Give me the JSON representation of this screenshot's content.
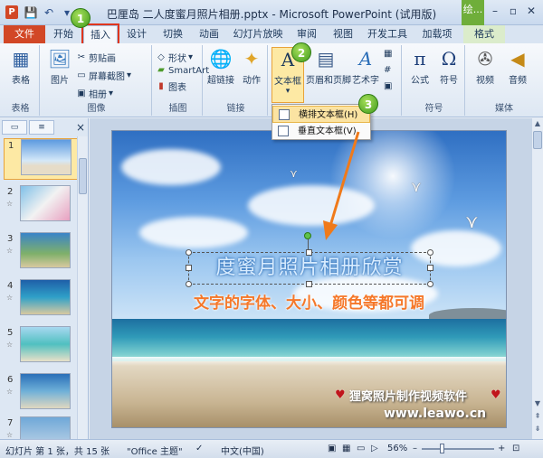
{
  "window": {
    "app_icon": "P",
    "title": "巴厘岛 二人度蜜月照片相册.pptx - Microsoft PowerPoint (试用版)",
    "context_tab_title": "绘...",
    "buttons": [
      "minimize-icon",
      "maximize-icon",
      "close-icon"
    ]
  },
  "qat": [
    "save-icon",
    "undo-icon",
    "customize-icon"
  ],
  "tabs": [
    {
      "label": "文件"
    },
    {
      "label": "开始"
    },
    {
      "label": "插入"
    },
    {
      "label": "设计"
    },
    {
      "label": "切换"
    },
    {
      "label": "动画"
    },
    {
      "label": "幻灯片放映"
    },
    {
      "label": "审阅"
    },
    {
      "label": "视图"
    },
    {
      "label": "开发工具"
    },
    {
      "label": "加载项"
    },
    {
      "label": "格式"
    }
  ],
  "ribbon": {
    "groups": [
      {
        "label": "表格",
        "buttons": [
          {
            "label": "表格"
          }
        ]
      },
      {
        "label": "图像",
        "buttons": [
          {
            "label": "图片"
          },
          {
            "label": "剪贴画"
          },
          {
            "label": "屏幕截图"
          },
          {
            "label": "相册"
          }
        ]
      },
      {
        "label": "插图",
        "buttons": [
          {
            "label": "形状"
          },
          {
            "label": "SmartArt"
          },
          {
            "label": "图表"
          }
        ]
      },
      {
        "label": "链接",
        "buttons": [
          {
            "label": "超链接"
          },
          {
            "label": "动作"
          }
        ]
      },
      {
        "label": "",
        "buttons": [
          {
            "label": "文本框"
          },
          {
            "label": "页眉和页脚"
          },
          {
            "label": "艺术字"
          }
        ]
      },
      {
        "label": "符号",
        "buttons": [
          {
            "label": "公式"
          },
          {
            "label": "符号"
          }
        ]
      },
      {
        "label": "媒体",
        "buttons": [
          {
            "label": "视频"
          },
          {
            "label": "音频"
          }
        ]
      }
    ]
  },
  "dropdown": {
    "items": [
      {
        "label": "横排文本框(H)"
      },
      {
        "label": "垂直文本框(V)"
      }
    ]
  },
  "badges": [
    "1",
    "2",
    "3"
  ],
  "left_panel": {
    "tabs": [
      "",
      ""
    ],
    "close": "×",
    "slides": [
      {
        "num": "1"
      },
      {
        "num": "2"
      },
      {
        "num": "3"
      },
      {
        "num": "4"
      },
      {
        "num": "5"
      },
      {
        "num": "6"
      },
      {
        "num": "7"
      }
    ]
  },
  "slide": {
    "title": "度蜜月照片相册欣赏",
    "subtitle": "文字的字体、大小、颜色等都可调",
    "watermark_line1": "狸窝照片制作视频软件",
    "watermark_line2": "www.leawo.cn"
  },
  "status": {
    "slide_info": "幻灯片 第 1 张，共 15 张",
    "theme": "\"Office 主题\"",
    "language": "中文(中国)",
    "zoom": "56%"
  },
  "colors": {
    "file_tab": "#d24726",
    "highlight": "#e0361d",
    "subtitle": "#f5782a",
    "badge": "#5fb82c"
  }
}
